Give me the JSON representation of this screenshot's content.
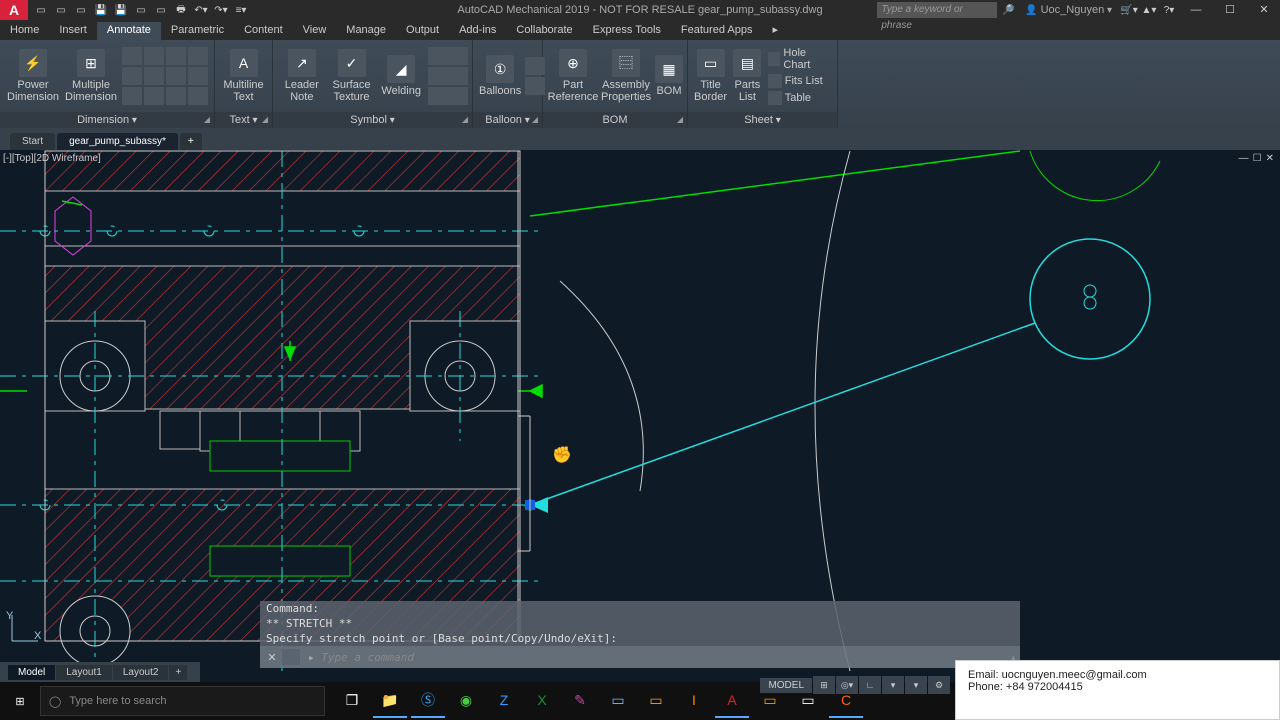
{
  "title": "AutoCAD Mechanical 2019 - NOT FOR RESALE    gear_pump_subassy.dwg",
  "search_placeholder": "Type a keyword or phrase",
  "user": "Uoc_Nguyen",
  "menus": [
    "Home",
    "Insert",
    "Annotate",
    "Parametric",
    "Content",
    "View",
    "Manage",
    "Output",
    "Add-ins",
    "Collaborate",
    "Express Tools",
    "Featured Apps"
  ],
  "menu_active": 2,
  "ribbon": {
    "dimension": {
      "power": "Power Dimension",
      "multiple": "Multiple Dimension",
      "title": "Dimension"
    },
    "text": {
      "multiline": "Multiline Text",
      "title": "Text"
    },
    "symbol": {
      "leader": "Leader Note",
      "surface": "Surface Texture",
      "weld": "Welding",
      "title": "Symbol"
    },
    "balloon": {
      "balloons": "Balloons",
      "title": "Balloon"
    },
    "bom": {
      "part": "Part Reference",
      "assy": "Assembly Properties",
      "bom": "BOM",
      "title": "BOM"
    },
    "sheet": {
      "title_b": "Title Border",
      "parts": "Parts List",
      "hole": "Hole Chart",
      "fits": "Fits List",
      "table": "Table",
      "title": "Sheet"
    }
  },
  "doctabs": {
    "start": "Start",
    "file": "gear_pump_subassy*"
  },
  "viewport_label": "[-][Top][2D Wireframe]",
  "layout_tabs": [
    "Model",
    "Layout1",
    "Layout2"
  ],
  "cmd_history": [
    "Command:",
    "** STRETCH **",
    "Specify stretch point or [Base point/Copy/Undo/eXit]:"
  ],
  "cmd_placeholder": "Type a command",
  "status_mode": "MODEL",
  "contact": {
    "email": "Email: uocnguyen.meec@gmail.com",
    "phone": "Phone: +84 972004415"
  },
  "task_search": "Type here to search",
  "ucs": {
    "x": "X",
    "y": "Y"
  }
}
